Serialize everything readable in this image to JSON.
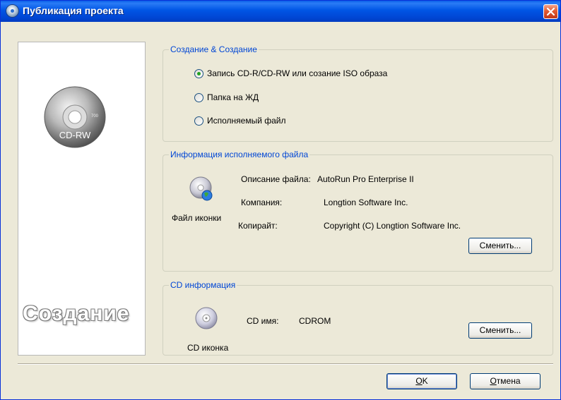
{
  "window": {
    "title": "Публикация проекта"
  },
  "side_panel": {
    "cd_label": "CD-RW",
    "cd_capacity": "700",
    "watermark": "Создание"
  },
  "creation_group": {
    "title": "Создание & Создание",
    "options": [
      {
        "label": "Запись CD-R/CD-RW или созание ISO образа",
        "selected": true
      },
      {
        "label": "Папка на ЖД",
        "selected": false
      },
      {
        "label": "Исполняемый файл",
        "selected": false
      }
    ]
  },
  "exe_group": {
    "title": "Информация исполняемого файла",
    "icon_caption": "Файл иконки",
    "description_label": "Описание файла:",
    "description_value": "AutoRun Pro Enterprise II",
    "company_label": "Компания:",
    "company_value": "Longtion Software Inc.",
    "copyright_label": "Копирайт:",
    "copyright_value": "Copyright (C) Longtion Software Inc.",
    "change_button": "Сменить..."
  },
  "cd_group": {
    "title": "CD информация",
    "icon_caption": "CD иконка",
    "name_label": "CD имя:",
    "name_value": "CDROM",
    "change_button": "Сменить..."
  },
  "footer": {
    "ok_first": "O",
    "ok_rest": "K",
    "cancel_first": "О",
    "cancel_rest": "тмена"
  },
  "colors": {
    "titlebar": "#0055e5",
    "group_title": "#0046d5",
    "dialog_bg": "#ece9d8"
  }
}
